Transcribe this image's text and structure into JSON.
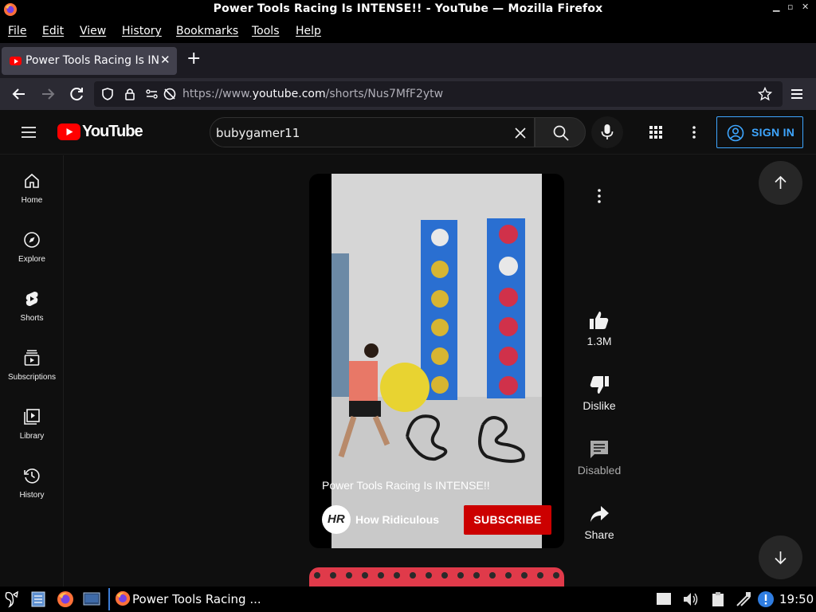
{
  "window": {
    "title": "Power Tools Racing Is INTENSE!! - YouTube — Mozilla Firefox",
    "controls": [
      "minimize",
      "maximize",
      "close"
    ]
  },
  "menubar": {
    "items": [
      "File",
      "Edit",
      "View",
      "History",
      "Bookmarks",
      "Tools",
      "Help"
    ]
  },
  "tabs": [
    {
      "label": "Power Tools Racing Is INTENSE!! - YouTube",
      "active": true
    }
  ],
  "navbar": {
    "url_prefix": "https://www.",
    "url_domain": "youtube.com",
    "url_path": "/shorts/Nus7MfF2ytw"
  },
  "youtube": {
    "logo_text": "YouTube",
    "search_query": "bubygamer11",
    "sign_in_label": "SIGN IN",
    "sidebar": [
      {
        "label": "Home",
        "icon": "home-icon"
      },
      {
        "label": "Explore",
        "icon": "compass-icon"
      },
      {
        "label": "Shorts",
        "icon": "shorts-icon"
      },
      {
        "label": "Subscriptions",
        "icon": "subscriptions-icon"
      },
      {
        "label": "Library",
        "icon": "library-icon"
      },
      {
        "label": "History",
        "icon": "history-icon"
      }
    ],
    "short": {
      "title": "Power Tools Racing Is INTENSE!!",
      "channel": "How Ridiculous",
      "channel_logo_text": "HR",
      "subscribe_label": "SUBSCRIBE"
    },
    "actions": {
      "like_count": "1.3M",
      "dislike_label": "Dislike",
      "comments_label": "Disabled",
      "share_label": "Share"
    }
  },
  "taskbar": {
    "task_label": "Power Tools Racing ...",
    "clock": "19:50"
  },
  "colors": {
    "yt_red": "#ff0000",
    "subscribe_red": "#cc0000",
    "sign_in_blue": "#3ea6ff",
    "page_bg": "#0f0f0f"
  }
}
